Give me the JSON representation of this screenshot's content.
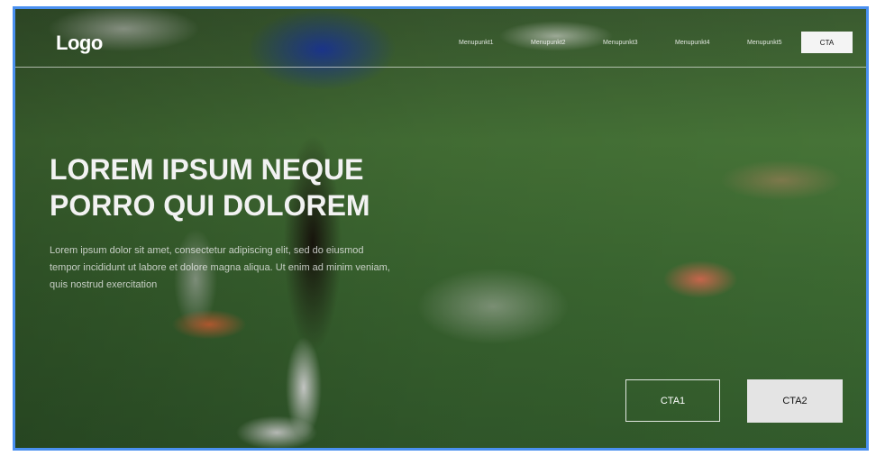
{
  "header": {
    "logo": "Logo",
    "menu": [
      "Menupunkt1",
      "Menupunkt2",
      "Menupunkt3",
      "Menupunkt4",
      "Menupunkt5"
    ],
    "cta_label": "CTA"
  },
  "hero": {
    "headline_line1": "LOREM IPSUM NEQUE",
    "headline_line2": "PORRO QUI DOLOREM",
    "body": "Lorem ipsum dolor sit amet, consectetur adipiscing elit, sed do eiusmod tempor incididunt ut labore et dolore magna aliqua. Ut enim ad minim veniam, quis nostrud exercitation",
    "cta1_label": "CTA1",
    "cta2_label": "CTA2"
  },
  "colors": {
    "frame_border": "#4a90f0",
    "cta_fill": "#e4e4e4",
    "text": "#ffffff"
  }
}
